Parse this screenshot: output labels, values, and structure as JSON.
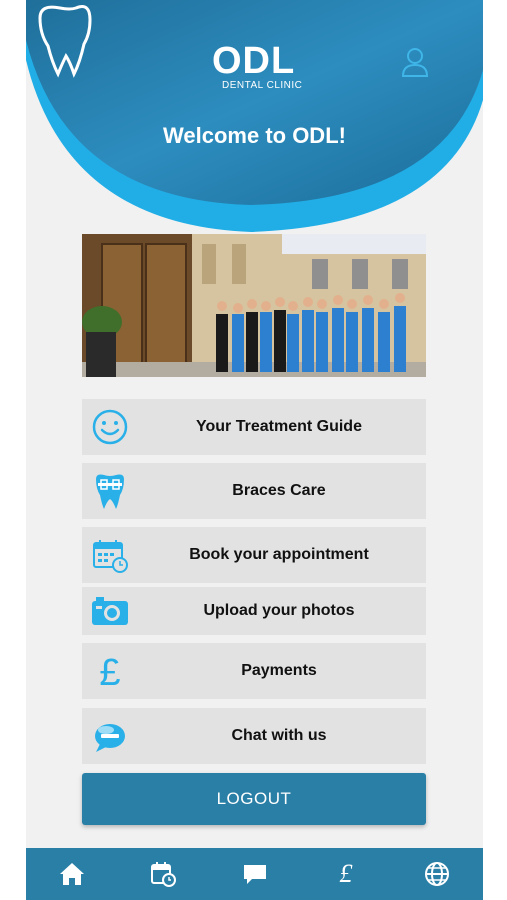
{
  "header": {
    "logo_name": "ODL",
    "logo_sub": "DENTAL CLINIC",
    "welcome": "Welcome to ODL!",
    "profile_icon": "user-icon"
  },
  "banner": {
    "image": "clinic-team-photo"
  },
  "menu": {
    "items": [
      {
        "label": "Your Treatment Guide",
        "icon": "smiley-icon"
      },
      {
        "label": "Braces Care",
        "icon": "tooth-braces-icon"
      },
      {
        "label": "Book your appointment",
        "icon": "calendar-clock-icon"
      },
      {
        "label": "Upload your photos",
        "icon": "camera-icon"
      },
      {
        "label": "Payments",
        "icon": "pound-icon"
      },
      {
        "label": "Chat with us",
        "icon": "live-chat-icon"
      }
    ]
  },
  "logout": {
    "label": "LOGOUT"
  },
  "bottom_nav": {
    "items": [
      {
        "icon": "home-icon"
      },
      {
        "icon": "calendar-icon"
      },
      {
        "icon": "chat-bubble-icon"
      },
      {
        "icon": "pound-icon",
        "label": "£"
      },
      {
        "icon": "globe-icon"
      }
    ]
  },
  "colors": {
    "header_blue": "#2b93c8",
    "header_ring": "#1aa6de",
    "accent": "#2a7fa6",
    "icon_blue": "#2ab0e8",
    "button_gray": "#e2e2e2",
    "background": "#f1f1f1"
  }
}
